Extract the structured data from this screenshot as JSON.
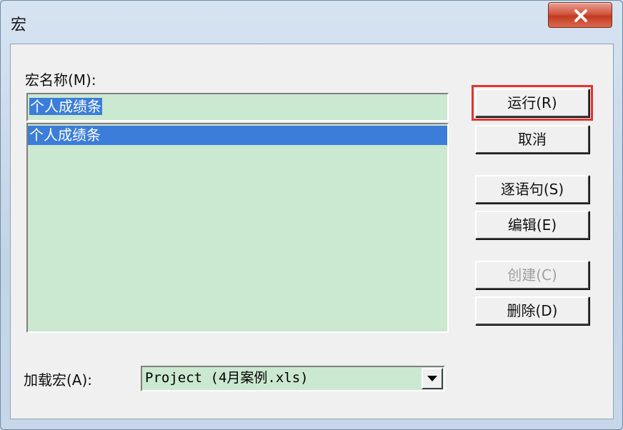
{
  "window": {
    "title": "宏"
  },
  "labels": {
    "macro_name": "宏名称(M):",
    "load_macro": "加载宏(A):"
  },
  "macro_name_input": {
    "value": "个人成绩条"
  },
  "macro_list": {
    "items": [
      "个人成绩条"
    ],
    "selected_index": 0
  },
  "buttons": {
    "run": "运行(R)",
    "cancel": "取消",
    "step_into": "逐语句(S)",
    "edit": "编辑(E)",
    "create": "创建(C)",
    "delete": "删除(D)"
  },
  "load_from": {
    "value": "Project (4月案例.xls)"
  },
  "colors": {
    "highlight_outline": "#e53333",
    "selection": "#3b7dd8",
    "field_bg": "#cbe8d0"
  },
  "icons": {
    "close": "close-x-icon",
    "dropdown": "chevron-down-icon"
  }
}
